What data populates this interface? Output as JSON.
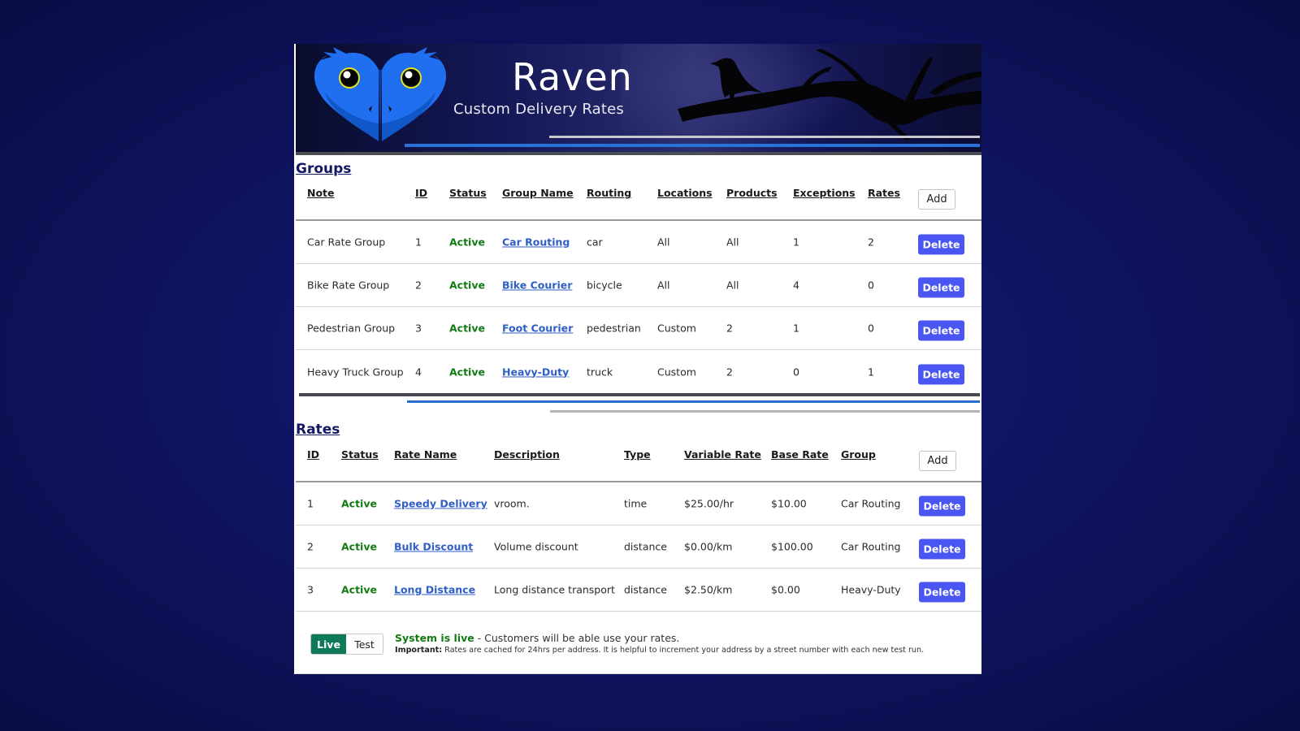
{
  "header": {
    "title": "Raven",
    "subtitle": "Custom Delivery Rates",
    "logo_icon": "owl-heart-logo-icon",
    "decor_icon": "raven-on-branch-icon"
  },
  "groups": {
    "title": "Groups",
    "columns": [
      "Note",
      "ID",
      "Status",
      "Group Name",
      "Routing",
      "Locations",
      "Products",
      "Exceptions",
      "Rates"
    ],
    "add_label": "Add",
    "delete_label": "Delete",
    "rows": [
      {
        "note": "Car Rate Group",
        "id": "1",
        "status": "Active",
        "group_name": "Car Routing",
        "routing": "car",
        "locations": "All",
        "products": "All",
        "exceptions": "1",
        "rates": "2"
      },
      {
        "note": "Bike Rate Group",
        "id": "2",
        "status": "Active",
        "group_name": "Bike Courier",
        "routing": "bicycle",
        "locations": "All",
        "products": "All",
        "exceptions": "4",
        "rates": "0"
      },
      {
        "note": "Pedestrian Group",
        "id": "3",
        "status": "Active",
        "group_name": "Foot Courier",
        "routing": "pedestrian",
        "locations": "Custom",
        "products": "2",
        "exceptions": "1",
        "rates": "0"
      },
      {
        "note": "Heavy Truck Group",
        "id": "4",
        "status": "Active",
        "group_name": "Heavy-Duty",
        "routing": "truck",
        "locations": "Custom",
        "products": "2",
        "exceptions": "0",
        "rates": "1"
      }
    ]
  },
  "rates": {
    "title": "Rates",
    "columns": [
      "ID",
      "Status",
      "Rate Name",
      "Description",
      "Type",
      "Variable Rate",
      "Base Rate",
      "Group"
    ],
    "add_label": "Add",
    "delete_label": "Delete",
    "rows": [
      {
        "id": "1",
        "status": "Active",
        "rate_name": "Speedy Delivery",
        "description": "vroom.",
        "type": "time",
        "variable_rate": "$25.00/hr",
        "base_rate": "$10.00",
        "group": "Car Routing"
      },
      {
        "id": "2",
        "status": "Active",
        "rate_name": "Bulk Discount",
        "description": "Volume discount",
        "type": "distance",
        "variable_rate": "$0.00/km",
        "base_rate": "$100.00",
        "group": "Car Routing"
      },
      {
        "id": "3",
        "status": "Active",
        "rate_name": "Long Distance",
        "description": "Long distance transport",
        "type": "distance",
        "variable_rate": "$2.50/km",
        "base_rate": "$0.00",
        "group": "Heavy-Duty"
      }
    ]
  },
  "footer": {
    "toggle_live": "Live",
    "toggle_test": "Test",
    "selected_mode": "Live",
    "status_bold": "System is live",
    "status_rest": " - Customers will be able use your rates.",
    "important_label": "Important:",
    "important_text": " Rates are cached for 24hrs per address. It is helpful to increment your address by a street number with each new test run."
  },
  "colors": {
    "status_active": "#117a11",
    "link": "#2f5fc4",
    "delete_button": "#4a56f2",
    "live_toggle": "#0f7a5a",
    "page_background": "#0f1462"
  }
}
